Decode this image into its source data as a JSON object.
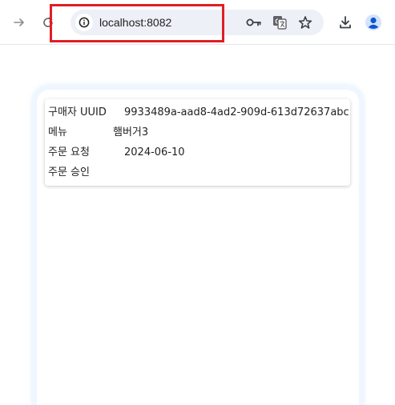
{
  "browser": {
    "url": "localhost:8082",
    "icons": {
      "forward": "arrow-right-icon",
      "reload": "reload-icon",
      "site_info": "info-icon",
      "passwords": "key-icon",
      "translate": "translate-icon",
      "bookmark": "star-icon",
      "downloads": "download-icon",
      "profile": "profile-icon"
    },
    "highlight_color": "#e01e24"
  },
  "order": {
    "buyer_uuid_label": "구매자 UUID",
    "buyer_uuid_value": "9933489a-aad8-4ad2-909d-613d72637abc",
    "menu_label": "메뉴",
    "menu_value": "햄버거3",
    "request_label": "주문 요청",
    "request_value": "2024-06-10",
    "approval_label": "주문 승인",
    "approval_value": ""
  }
}
